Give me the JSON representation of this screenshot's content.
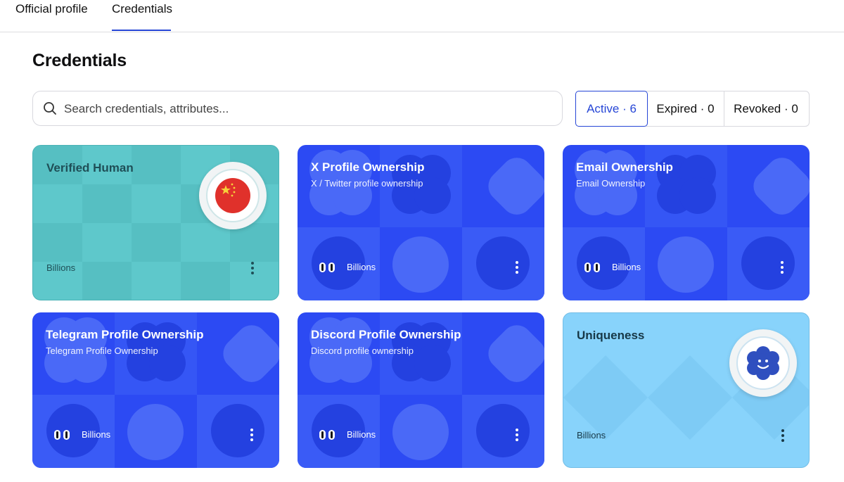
{
  "tabs": [
    {
      "label": "Official profile",
      "active": false
    },
    {
      "label": "Credentials",
      "active": true
    }
  ],
  "page_title": "Credentials",
  "search": {
    "placeholder": "Search credentials, attributes...",
    "value": "",
    "icon": "search-icon"
  },
  "filters": [
    {
      "label": "Active · 6",
      "active": true
    },
    {
      "label": "Expired · 0",
      "active": false
    },
    {
      "label": "Revoked · 0",
      "active": false
    }
  ],
  "cards": [
    {
      "title": "Verified Human",
      "subtitle": "",
      "issuer": "Billions",
      "style": "teal",
      "badge": "china-flag-icon"
    },
    {
      "title": "X Profile Ownership",
      "subtitle": "X / Twitter profile ownership",
      "issuer": "Billions",
      "style": "blue"
    },
    {
      "title": "Email Ownership",
      "subtitle": "Email Ownership",
      "issuer": "Billions",
      "style": "blue"
    },
    {
      "title": "Telegram Profile Ownership",
      "subtitle": "Telegram Profile Ownership",
      "issuer": "Billions",
      "style": "blue"
    },
    {
      "title": "Discord Profile Ownership",
      "subtitle": "Discord profile ownership",
      "issuer": "Billions",
      "style": "blue"
    },
    {
      "title": "Uniqueness",
      "subtitle": "",
      "issuer": "Billions",
      "style": "sky",
      "badge": "smiley-flower-icon"
    }
  ],
  "colors": {
    "accent": "#2646d6",
    "card_blue": "#2c4af3",
    "card_teal": "#5ec8cb",
    "card_sky": "#88d3fb"
  }
}
